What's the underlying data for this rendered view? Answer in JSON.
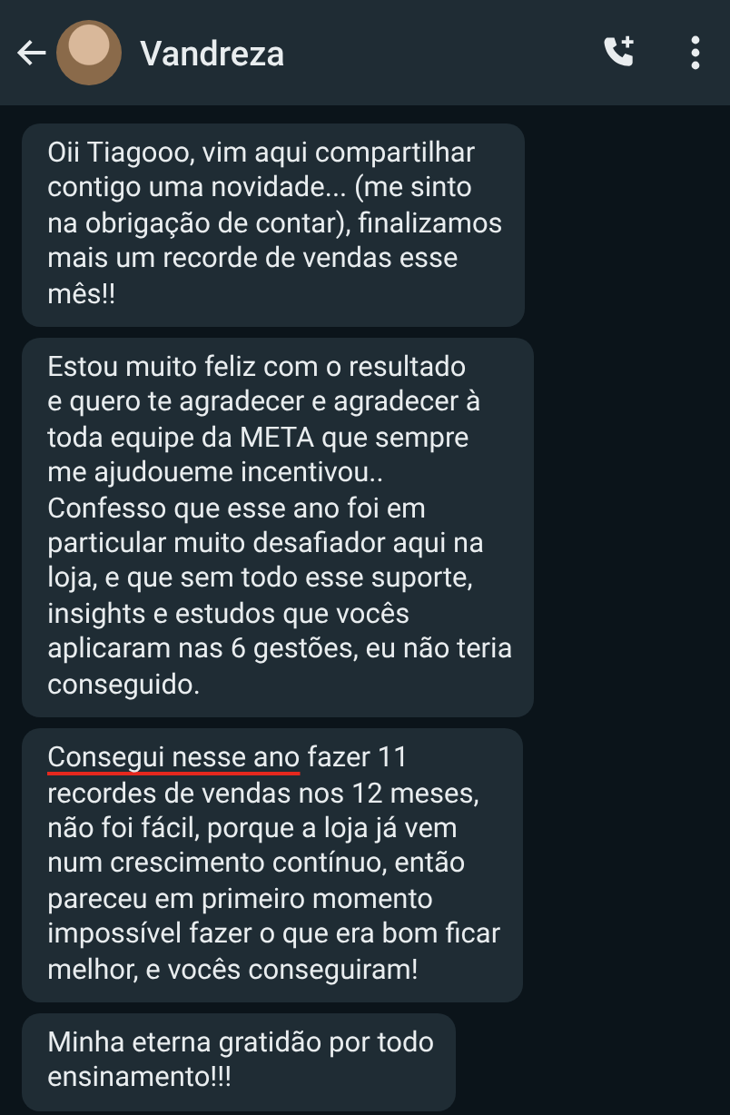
{
  "header": {
    "contact_name": "Vandreza"
  },
  "messages": [
    {
      "lines": [
        "Oii Tiagooo, vim aqui compartilhar",
        "contigo uma novidade... (me sinto",
        "na obrigação de contar), finalizamos",
        "mais um recorde de vendas esse",
        "mês!!"
      ]
    },
    {
      "lines": [
        "Estou muito feliz com o resultado",
        "e quero te agradecer e agradecer à",
        "toda equipe da META que sempre",
        "me ajudoueme incentivou..",
        "Confesso que esse ano foi em",
        "particular muito desafiador aqui na",
        "loja, e que sem todo esse suporte,",
        "insights e estudos que vocês",
        "aplicaram nas 6 gestões, eu não teria",
        "conseguido."
      ]
    },
    {
      "underlined_lead": "Consegui nesse ano",
      "lines": [
        " fazer 11",
        "recordes de vendas nos 12 meses,",
        "não foi fácil, porque a loja já vem",
        "num crescimento contínuo, então",
        "pareceu em primeiro momento",
        "impossível fazer o que era bom ficar",
        "melhor, e vocês conseguiram!"
      ]
    },
    {
      "lines": [
        "Minha eterna gratidão por todo",
        "ensinamento!!!"
      ]
    }
  ]
}
